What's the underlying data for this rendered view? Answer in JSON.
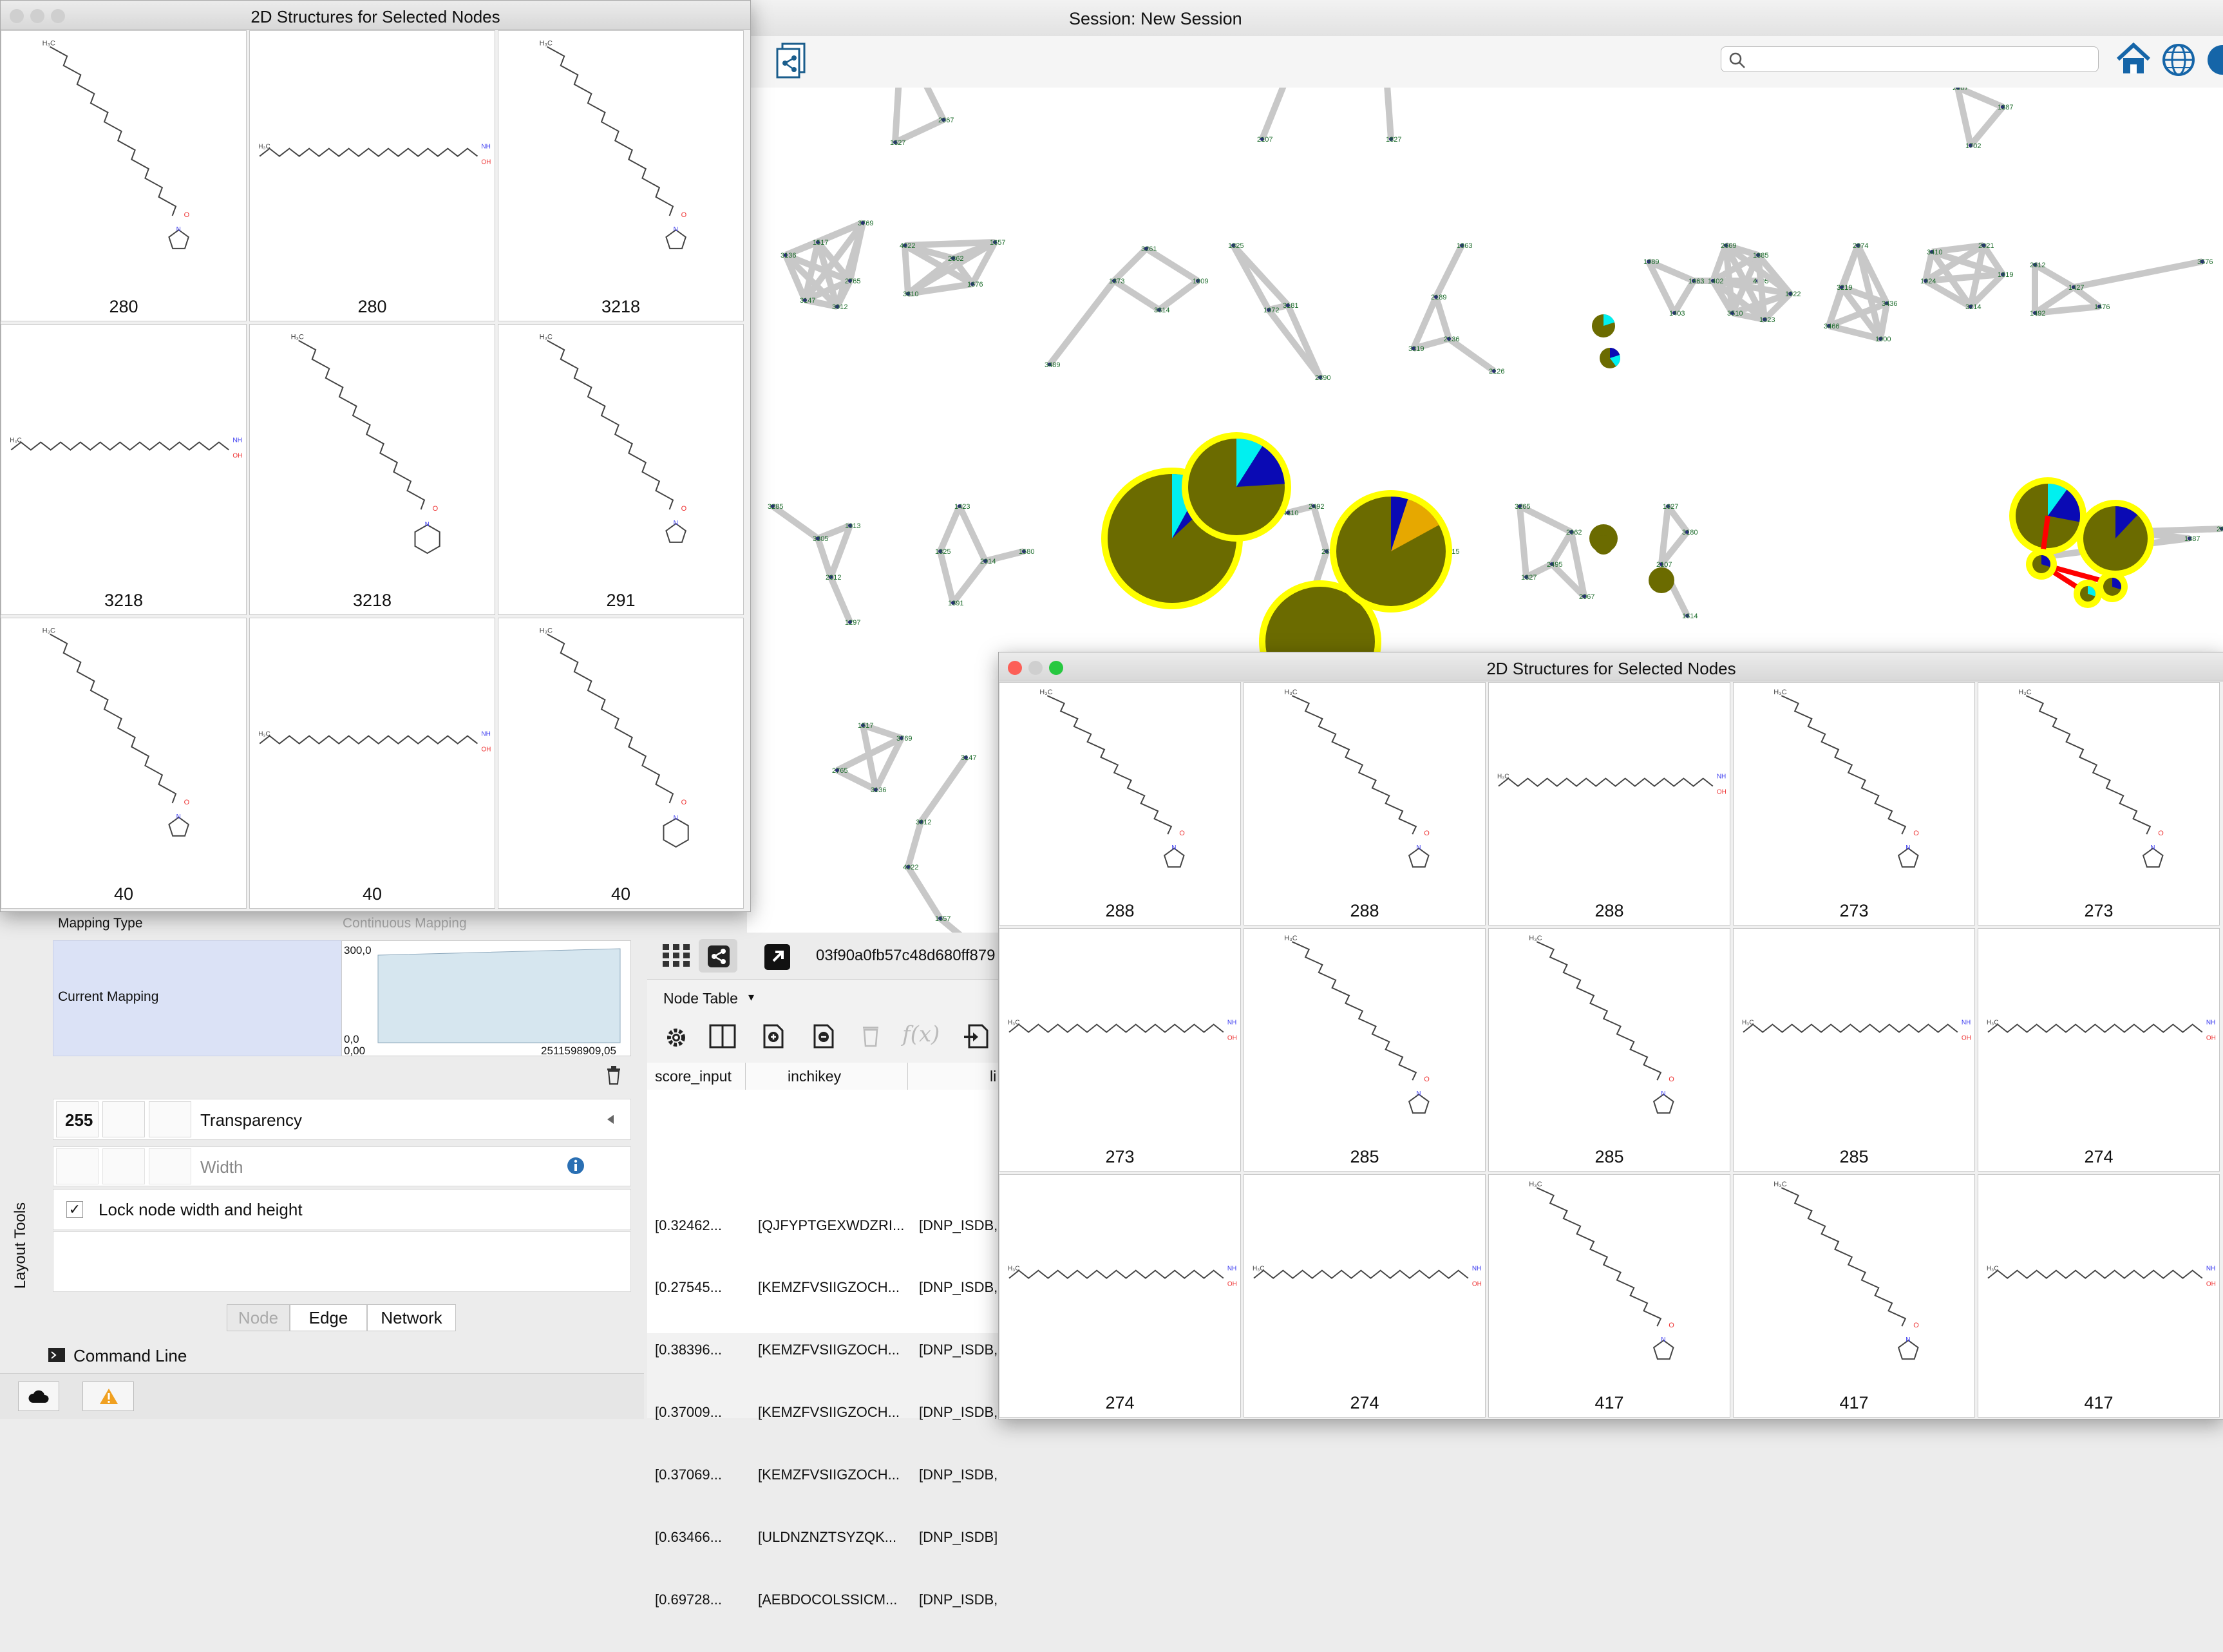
{
  "app": {
    "session_title": "Session: New Session",
    "search_placeholder": ""
  },
  "structures_left": {
    "title": "2D Structures for Selected Nodes",
    "cells": [
      {
        "label": "280",
        "style": "diag"
      },
      {
        "label": "280",
        "style": "horiz"
      },
      {
        "label": "3218",
        "style": "diag"
      },
      {
        "label": "3218",
        "style": "horiz"
      },
      {
        "label": "3218",
        "style": "diag6"
      },
      {
        "label": "291",
        "style": "diag"
      },
      {
        "label": "40",
        "style": "diag"
      },
      {
        "label": "40",
        "style": "horiz"
      },
      {
        "label": "40",
        "style": "diag6"
      }
    ]
  },
  "structures_right": {
    "title": "2D Structures for Selected Nodes",
    "cells": [
      {
        "label": "288",
        "style": "diag"
      },
      {
        "label": "288",
        "style": "diag"
      },
      {
        "label": "288",
        "style": "horiz"
      },
      {
        "label": "273",
        "style": "diag"
      },
      {
        "label": "273",
        "style": "diag"
      },
      {
        "label": "273",
        "style": "horiz"
      },
      {
        "label": "285",
        "style": "diag"
      },
      {
        "label": "285",
        "style": "diag"
      },
      {
        "label": "285",
        "style": "horiz"
      },
      {
        "label": "274",
        "style": "horiz"
      },
      {
        "label": "274",
        "style": "horiz"
      },
      {
        "label": "274",
        "style": "horiz"
      },
      {
        "label": "417",
        "style": "diag"
      },
      {
        "label": "417",
        "style": "diag"
      },
      {
        "label": "417",
        "style": "horiz"
      }
    ]
  },
  "style_panel": {
    "mapping_type_label": "Mapping Type",
    "mapping_type_value": "Continuous Mapping",
    "current_mapping_label": "Current Mapping",
    "ymax": "300,0",
    "ymin": "0,0",
    "xmin": "0,00",
    "xmax": "2511598909,05",
    "transparency_value": "255",
    "transparency_label": "Transparency",
    "width_label": "Width",
    "lock_label": "Lock node width and height",
    "lock_checked": true,
    "tabs": [
      "Node",
      "Edge",
      "Network"
    ],
    "side_tab": "Layout Tools",
    "command_line": "Command Line"
  },
  "table_panel": {
    "network_id": "03f90a0fb57c48d680ff879",
    "table_name": "Node Table",
    "columns": [
      "score_input",
      "inchikey",
      "li"
    ],
    "rows": [
      [
        "[0.32462...",
        "[QJFYPTGEXWDZRI...",
        "[DNP_ISDB,"
      ],
      [
        "[0.27545...",
        "[KEMZFVSIIGZOCH...",
        "[DNP_ISDB,"
      ],
      [
        "[0.38396...",
        "[KEMZFVSIIGZOCH...",
        "[DNP_ISDB,"
      ],
      [
        "[0.37009...",
        "[KEMZFVSIIGZOCH...",
        "[DNP_ISDB,"
      ],
      [
        "[0.37069...",
        "[KEMZFVSIIGZOCH...",
        "[DNP_ISDB,"
      ],
      [
        "[0.63466...",
        "[ULDNZNZTSYZQK...",
        "[DNP_ISDB]"
      ],
      [
        "[0.69728...",
        "[AEBDOCOLSSICM...",
        "[DNP_ISDB,"
      ]
    ]
  },
  "network": {
    "node_labels": [
      "1827",
      "2067",
      "1627",
      "3180",
      "2107",
      "1614",
      "1827",
      "2667",
      "1702",
      "1387",
      "1517",
      "3769",
      "2765",
      "3136",
      "3147",
      "3912",
      "4022",
      "1657",
      "3810",
      "1676",
      "2862",
      "3261",
      "1873",
      "3814",
      "3489",
      "1909",
      "1825",
      "1972",
      "2890",
      "3181",
      "1963",
      "2189",
      "3319",
      "2136",
      "2126",
      "1989",
      "1663",
      "1403",
      "4005",
      "2669",
      "1885",
      "1922",
      "1023",
      "3510",
      "1402",
      "2974",
      "3219",
      "3466",
      "1900",
      "3436",
      "3410",
      "2021",
      "1919",
      "3214",
      "1924",
      "2612",
      "1427",
      "1492",
      "1476",
      "3576",
      "3285",
      "3305",
      "1913",
      "2012",
      "1297",
      "1423",
      "1825",
      "1391",
      "2914",
      "1580",
      "4310",
      "2492",
      "2656",
      "2477",
      "1180",
      "2150",
      "2140",
      "1815",
      "4183",
      "3265",
      "2962",
      "2495"
    ]
  },
  "colors": {
    "node_olive": "#6b6b00",
    "node_blue": "#0a0ab4",
    "node_cyan": "#00f0f0",
    "highlight": "#ffff00",
    "edge": "#c8c8c8",
    "edge_selected": "#ff0000",
    "accent": "#0a5bb0"
  }
}
